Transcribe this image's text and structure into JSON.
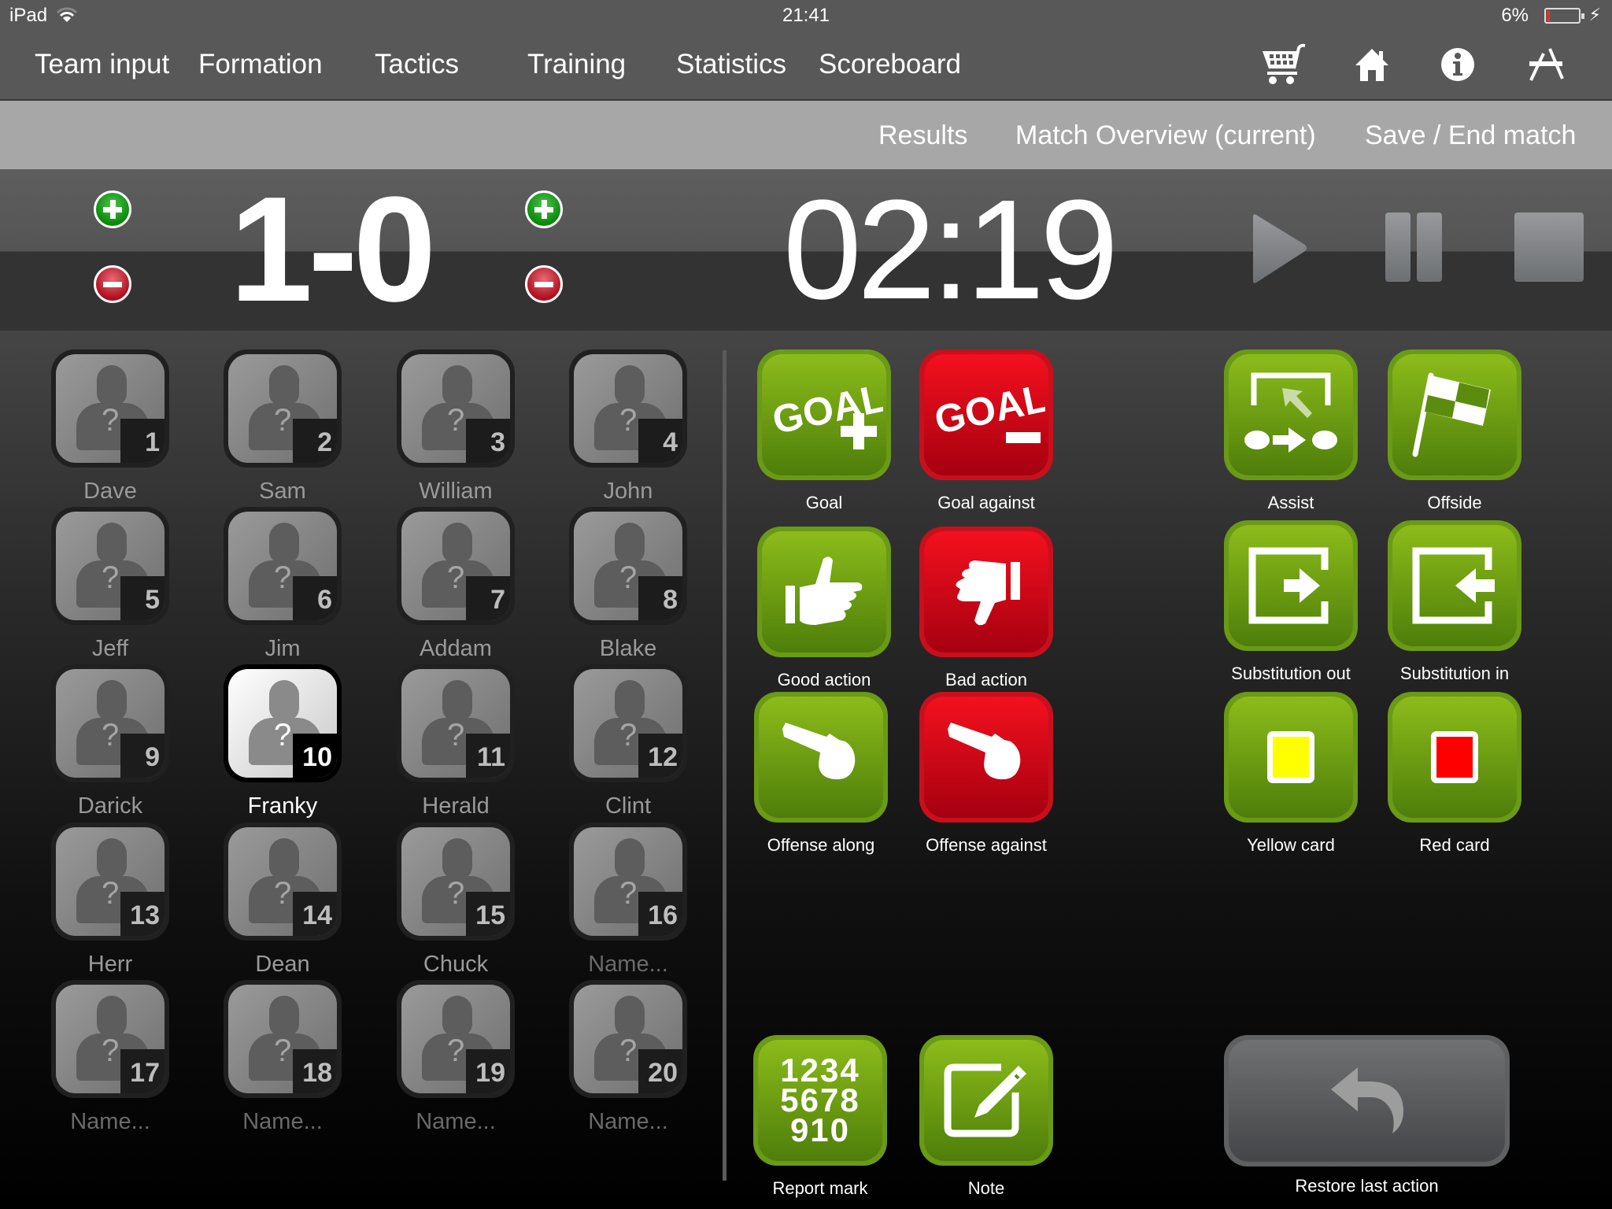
{
  "status_bar": {
    "carrier": "iPad",
    "time": "21:41",
    "battery_percent": "6%",
    "battery_level": 0.06,
    "charging": true
  },
  "nav": {
    "items": [
      {
        "label": "Team input"
      },
      {
        "label": "Formation"
      },
      {
        "label": "Tactics"
      },
      {
        "label": "Training"
      },
      {
        "label": "Statistics"
      },
      {
        "label": "Scoreboard"
      }
    ],
    "icons": [
      "cart-icon",
      "home-icon",
      "info-icon",
      "app-store-icon"
    ]
  },
  "subnav": {
    "items": [
      {
        "label": "Results"
      },
      {
        "label": "Match Overview (current)"
      },
      {
        "label": "Save / End match"
      }
    ]
  },
  "scoreboard": {
    "score": "1-0",
    "home_score": 1,
    "away_score": 0,
    "timer": "02:19"
  },
  "players": [
    {
      "number": "1",
      "name": "Dave"
    },
    {
      "number": "2",
      "name": "Sam"
    },
    {
      "number": "3",
      "name": "William"
    },
    {
      "number": "4",
      "name": "John"
    },
    {
      "number": "5",
      "name": "Jeff"
    },
    {
      "number": "6",
      "name": "Jim"
    },
    {
      "number": "7",
      "name": "Addam"
    },
    {
      "number": "8",
      "name": "Blake"
    },
    {
      "number": "9",
      "name": "Darick"
    },
    {
      "number": "10",
      "name": "Franky",
      "selected": true
    },
    {
      "number": "11",
      "name": "Herald"
    },
    {
      "number": "12",
      "name": "Clint"
    },
    {
      "number": "13",
      "name": "Herr"
    },
    {
      "number": "14",
      "name": "Dean"
    },
    {
      "number": "15",
      "name": "Chuck"
    },
    {
      "number": "16",
      "name": "Name...",
      "placeholder": true
    },
    {
      "number": "17",
      "name": "Name...",
      "placeholder": true
    },
    {
      "number": "18",
      "name": "Name...",
      "placeholder": true
    },
    {
      "number": "19",
      "name": "Name...",
      "placeholder": true
    },
    {
      "number": "20",
      "name": "Name...",
      "placeholder": true
    }
  ],
  "actions": {
    "goal": {
      "label": "Goal",
      "icon_text": "GOAL"
    },
    "goal_against": {
      "label": "Goal against",
      "icon_text": "GOAL"
    },
    "good_action": {
      "label": "Good action"
    },
    "bad_action": {
      "label": "Bad action"
    },
    "offense_along": {
      "label": "Offense along"
    },
    "offense_against": {
      "label": "Offense against"
    },
    "assist": {
      "label": "Assist"
    },
    "offside": {
      "label": "Offside"
    },
    "substitution_out": {
      "label": "Substitution out"
    },
    "substitution_in": {
      "label": "Substitution in"
    },
    "yellow_card": {
      "label": "Yellow card"
    },
    "red_card": {
      "label": "Red card"
    },
    "report_mark": {
      "label": "Report mark",
      "icon_lines": [
        "1234",
        "5678",
        "910"
      ]
    },
    "note": {
      "label": "Note"
    },
    "restore": {
      "label": "Restore last action"
    }
  },
  "colors": {
    "green_button": "#6a9a16",
    "red_button": "#c8101c",
    "yellow_card": "#ffff00",
    "red_card": "#ff0000"
  }
}
